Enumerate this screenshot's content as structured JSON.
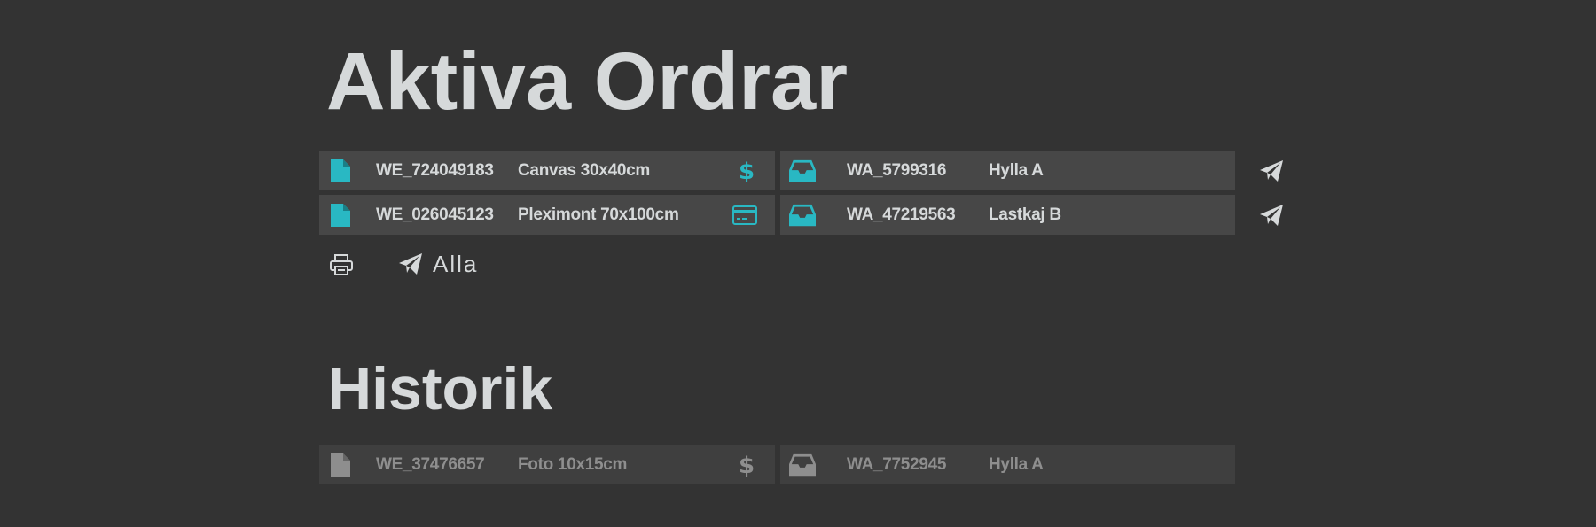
{
  "colors": {
    "background": "#333333",
    "row": "#474747",
    "history_row": "#3f3f3f",
    "accent": "#29b8c3",
    "text": "#d6d9da",
    "muted": "#8e8e8e"
  },
  "active": {
    "title": "Aktiva Ordrar",
    "orders": [
      {
        "file_icon": "file-icon",
        "order_id": "WE_724049183",
        "product": "Canvas 30x40cm",
        "payment_icon": "dollar-icon",
        "box_icon": "inbox-icon",
        "shipment_id": "WA_5799316",
        "location": "Hylla A",
        "send_icon": "paper-plane-icon"
      },
      {
        "file_icon": "file-icon",
        "order_id": "WE_026045123",
        "product": "Pleximont 70x100cm",
        "payment_icon": "credit-card-icon",
        "box_icon": "inbox-icon",
        "shipment_id": "WA_47219563",
        "location": "Lastkaj B",
        "send_icon": "paper-plane-icon"
      }
    ],
    "actions": {
      "print_icon": "printer-icon",
      "send_all_icon": "paper-plane-icon",
      "send_all_label": "Alla"
    }
  },
  "history": {
    "title": "Historik",
    "orders": [
      {
        "file_icon": "file-icon",
        "order_id": "WE_37476657",
        "product": "Foto 10x15cm",
        "payment_icon": "dollar-icon",
        "box_icon": "inbox-icon",
        "shipment_id": "WA_7752945",
        "location": "Hylla A"
      }
    ]
  }
}
